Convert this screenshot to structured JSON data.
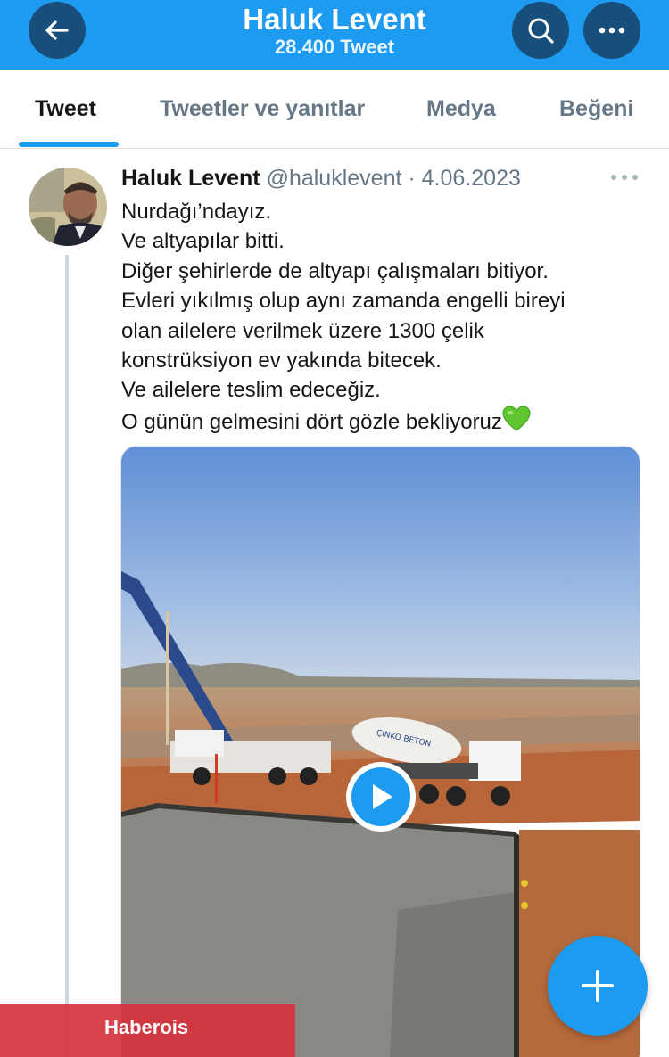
{
  "header": {
    "title": "Haluk Levent",
    "subtitle": "28.400 Tweet",
    "back_icon": "arrow-left-icon",
    "search_icon": "search-icon",
    "more_icon": "more-horizontal-icon"
  },
  "tabs": [
    {
      "label": "Tweet",
      "active": true
    },
    {
      "label": "Tweetler ve yanıtlar",
      "active": false
    },
    {
      "label": "Medya",
      "active": false
    },
    {
      "label": "Beğeni",
      "active": false
    }
  ],
  "tweet": {
    "author_name": "Haluk Levent",
    "handle": "@haluklevent",
    "separator": "·",
    "date": "4.06.2023",
    "lines": [
      "Nurdağı’ndayız.",
      "Ve altyapılar bitti.",
      "Diğer şehirlerde de altyapı çalışmaları bitiyor.",
      "Evleri yıkılmış olup aynı zamanda engelli bireyi",
      "olan ailelere verilmek üzere 1300 çelik",
      "konstrüksiyon ev yakında bitecek.",
      "Ve ailelere teslim edeceğiz.",
      "O günün gelmesini dört gözle bekliyoruz"
    ],
    "emoji": "green-heart-icon",
    "media_type": "video",
    "truck_label": "ÇİNKO BETON"
  },
  "fab_icon": "plus-icon",
  "watermark": "Haberois",
  "colors": {
    "accent": "#1d9bf0",
    "header_button": "#174e7a",
    "text_primary": "#14171a",
    "text_secondary": "#657786",
    "watermark_bg": "#d6303a"
  }
}
